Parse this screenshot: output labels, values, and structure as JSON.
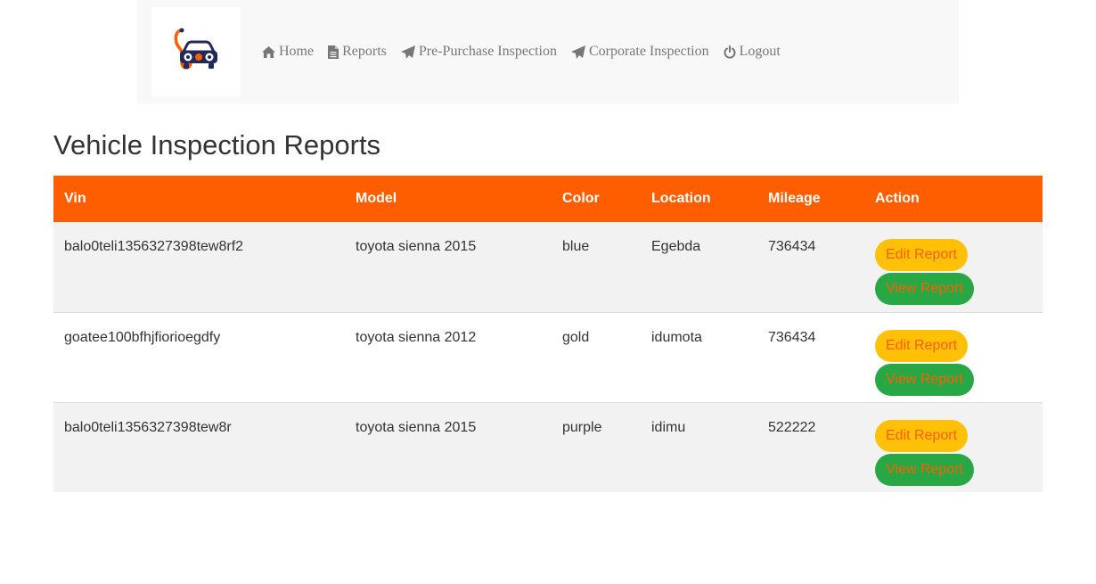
{
  "nav": {
    "items": [
      {
        "label": "Home",
        "icon": "home-icon"
      },
      {
        "label": "Reports",
        "icon": "document-icon"
      },
      {
        "label": "Pre-Purchase Inspection",
        "icon": "paper-plane-icon"
      },
      {
        "label": "Corporate Inspection",
        "icon": "paper-plane-icon"
      },
      {
        "label": "Logout",
        "icon": "power-icon"
      }
    ]
  },
  "page": {
    "title": "Vehicle Inspection Reports"
  },
  "table": {
    "headers": [
      "Vin",
      "Model",
      "Color",
      "Location",
      "Mileage",
      "Action"
    ],
    "rows": [
      {
        "vin": "balo0teli1356327398tew8rf2",
        "model": "toyota sienna 2015",
        "color": "blue",
        "location": "Egebda",
        "mileage": "736434"
      },
      {
        "vin": "goatee100bfhjfiorioegdfy",
        "model": "toyota sienna 2012",
        "color": "gold",
        "location": "idumota",
        "mileage": "736434"
      },
      {
        "vin": "balo0teli1356327398tew8r",
        "model": "toyota sienna 2015",
        "color": "purple",
        "location": "idimu",
        "mileage": "522222"
      }
    ],
    "edit_label": "Edit Report",
    "view_label": "View Report"
  },
  "colors": {
    "accent": "#ff5e00",
    "edit_button": "#ffc107",
    "view_button": "#28a745",
    "navbar_bg": "#f8f8f8"
  }
}
